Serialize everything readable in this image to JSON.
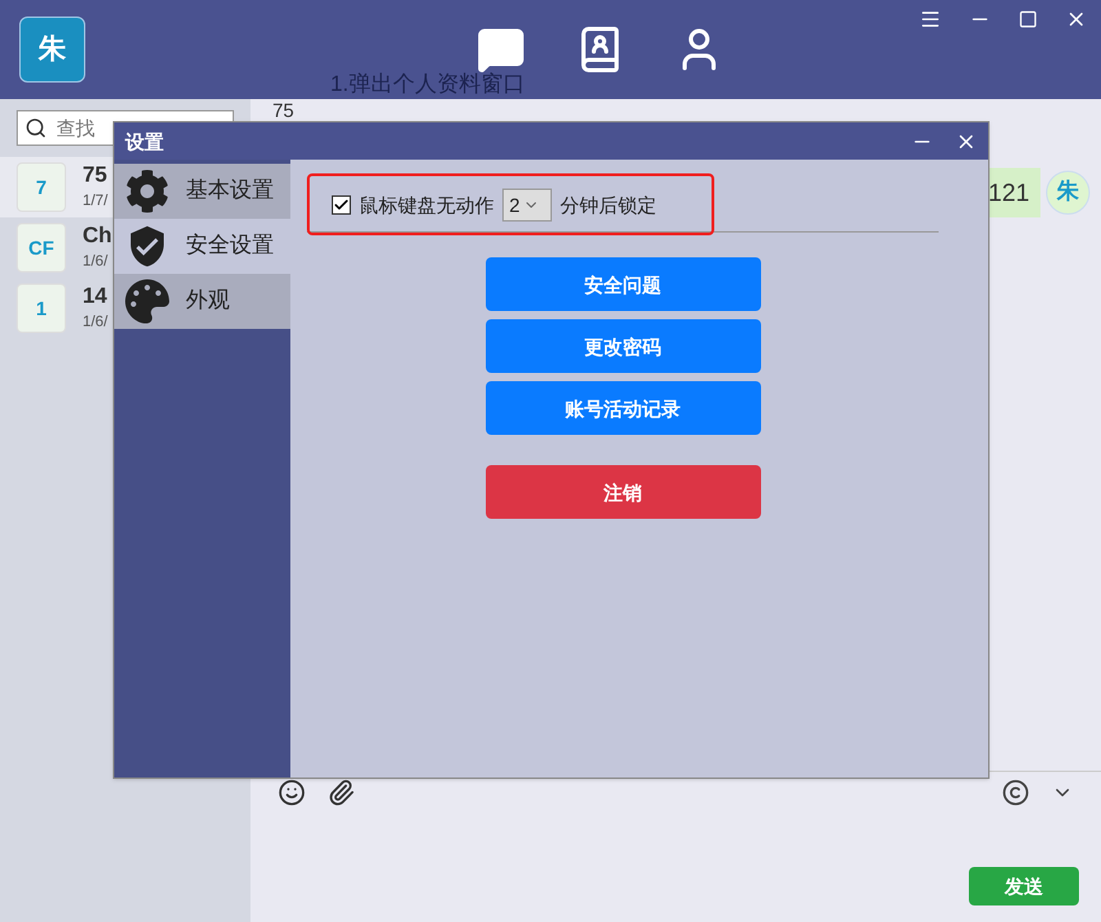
{
  "app": {
    "avatar": "朱",
    "nav": [
      {
        "kind": "chat",
        "selected": true
      },
      {
        "kind": "contacts",
        "selected": false
      },
      {
        "kind": "profile",
        "selected": false
      }
    ]
  },
  "background_note": "1.弹出个人资料窗口",
  "search": {
    "placeholder": "查找"
  },
  "conversations": [
    {
      "badge": "7",
      "name": "75",
      "time": "1/7/",
      "selected": true
    },
    {
      "badge": "CF",
      "name": "Ch",
      "time": "1/6/",
      "selected": false
    },
    {
      "badge": "1",
      "name": "14",
      "time": "1/6/",
      "selected": false
    }
  ],
  "chat": {
    "title": "75",
    "messages": [
      {
        "text": "121",
        "avatar": "朱"
      }
    ],
    "send_button": "发送"
  },
  "dialog": {
    "title": "设置",
    "menu": [
      {
        "kind": "gear",
        "label": "基本设置",
        "selected": false
      },
      {
        "kind": "shield",
        "label": "安全设置",
        "selected": true
      },
      {
        "kind": "palette",
        "label": "外观",
        "selected": false
      }
    ],
    "lock": {
      "checked": true,
      "before": "鼠标键盘无动作",
      "minutes": "2",
      "after": "分钟后锁定"
    },
    "buttons": [
      {
        "label": "安全问题",
        "kind": "primary"
      },
      {
        "label": "更改密码",
        "kind": "primary"
      },
      {
        "label": "账号活动记录",
        "kind": "primary"
      },
      {
        "label": "注销",
        "kind": "danger"
      }
    ]
  }
}
